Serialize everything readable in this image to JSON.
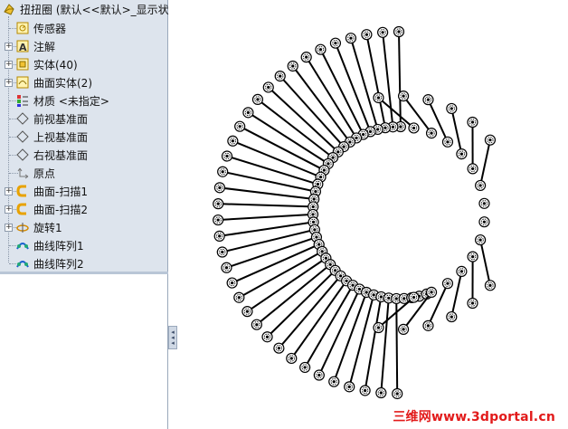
{
  "tree": {
    "root": {
      "label": "扭扭圈 (默认<<默认>_显示状"
    },
    "items": [
      {
        "label": "传感器",
        "icon": "sensor-icon",
        "expandable": false
      },
      {
        "label": "注解",
        "icon": "annotation-icon",
        "expandable": true
      },
      {
        "label": "实体(40)",
        "icon": "solid-bodies-icon",
        "expandable": true
      },
      {
        "label": "曲面实体(2)",
        "icon": "surface-bodies-icon",
        "expandable": true
      },
      {
        "label": "材质 <未指定>",
        "icon": "material-icon",
        "expandable": false
      },
      {
        "label": "前视基准面",
        "icon": "plane-icon",
        "expandable": false
      },
      {
        "label": "上视基准面",
        "icon": "plane-icon",
        "expandable": false
      },
      {
        "label": "右视基准面",
        "icon": "plane-icon",
        "expandable": false
      },
      {
        "label": "原点",
        "icon": "origin-icon",
        "expandable": false
      },
      {
        "label": "曲面-扫描1",
        "icon": "surface-sweep-icon",
        "expandable": true
      },
      {
        "label": "曲面-扫描2",
        "icon": "surface-sweep-icon",
        "expandable": true
      },
      {
        "label": "旋转1",
        "icon": "revolve-icon",
        "expandable": true
      },
      {
        "label": "曲线阵列1",
        "icon": "curve-pattern-icon",
        "expandable": false
      },
      {
        "label": "曲线阵列2",
        "icon": "curve-pattern-icon",
        "expandable": false
      }
    ]
  },
  "splitter": {
    "arrows": "◂◂"
  },
  "viewport": {
    "spoke_count": 40
  },
  "watermark": "三维网www.3dportal.cn"
}
